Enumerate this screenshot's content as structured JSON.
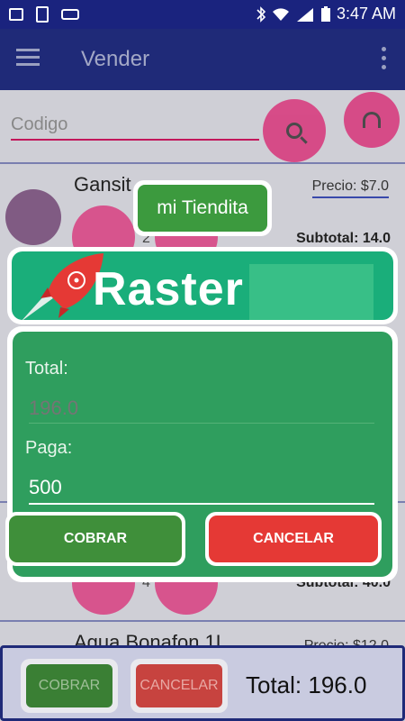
{
  "status_bar": {
    "time": "3:47 AM"
  },
  "app_bar": {
    "title": "Vender"
  },
  "search": {
    "placeholder": "Codigo"
  },
  "items": [
    {
      "name": "Gansit",
      "price": "Precio: $7.0",
      "qty": "2",
      "subtotal": "Subtotal: 14.0"
    },
    {
      "qty": "4",
      "subtotal": "Subtotal: 40.0"
    },
    {
      "name": "Agua Bonafon 1L",
      "price": "Precio: $12.0"
    }
  ],
  "bottom_bar": {
    "cobrar_label": "COBRAR",
    "cancelar_label": "CANCELAR",
    "total": "Total: 196.0"
  },
  "dialog": {
    "store_name": "mi Tiendita",
    "brand": "Raster",
    "total_label": "Total:",
    "total_value": "196.0",
    "paga_label": "Paga:",
    "paga_value": "500",
    "cobrar_label": "COBRAR",
    "cancelar_label": "CANCELAR"
  },
  "colors": {
    "primary": "#1f2a78",
    "accent": "#d8357a",
    "dialog_green": "#2f9e5e",
    "brand_teal": "#1aae7a",
    "cancel_red": "#e53935"
  }
}
